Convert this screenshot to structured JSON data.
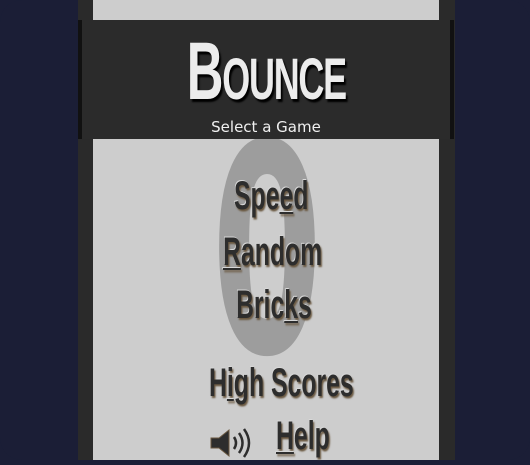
{
  "game": {
    "title_first": "B",
    "title_rest": "OUNCE",
    "subtitle": "Select a Game",
    "background_digit": "0"
  },
  "menu": {
    "speed": {
      "pre": "Spe",
      "key": "e",
      "post": "d"
    },
    "random": {
      "pre": "",
      "key": "R",
      "post": "andom"
    },
    "bricks": {
      "pre": "Bric",
      "key": "k",
      "post": "s"
    },
    "high_scores": {
      "pre": "H",
      "key": "i",
      "post": "gh Scores"
    },
    "help": {
      "pre": "",
      "key": "H",
      "post": "elp"
    }
  },
  "icons": {
    "sound": "speaker-volume-icon"
  },
  "colors": {
    "background": "#1b1e36",
    "panel": "#cdcdcd",
    "header": "#2b2b2b",
    "menu_text": "#2d2d2d",
    "digit": "#9d9d9d"
  }
}
